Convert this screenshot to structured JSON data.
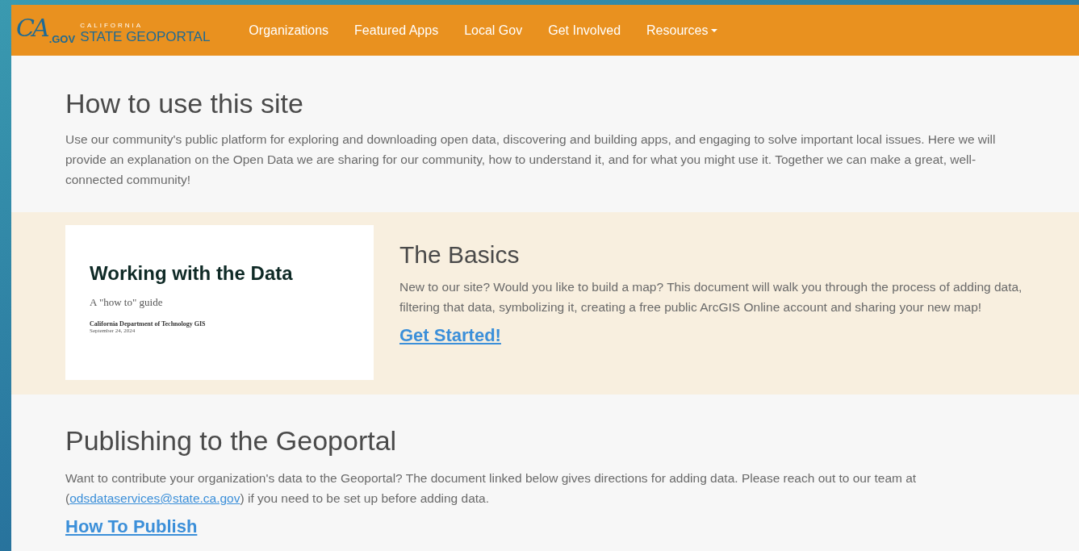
{
  "header": {
    "logo": {
      "mark": "CA",
      "gov": ".GOV",
      "state": "CALIFORNIA",
      "title": "STATE GEOPORTAL"
    },
    "nav": [
      {
        "label": "Organizations",
        "dropdown": false
      },
      {
        "label": "Featured Apps",
        "dropdown": false
      },
      {
        "label": "Local Gov",
        "dropdown": false
      },
      {
        "label": "Get Involved",
        "dropdown": false
      },
      {
        "label": "Resources",
        "dropdown": true
      }
    ]
  },
  "intro": {
    "title": "How to use this site",
    "text": "Use our community's public platform for exploring and downloading open data, discovering and building apps, and engaging to solve important local issues. Here we will provide an explanation on the Open Data we are sharing for our community, how to understand it, and for what you might use it. Together we can make a great, well-connected community!"
  },
  "basics": {
    "document": {
      "title": "Working with the Data",
      "subtitle": "A \"how to\" guide",
      "author": "California Department of Technology GIS",
      "date": "September 24, 2024"
    },
    "title": "The Basics",
    "text": "New to our site? Would you like to build a map? This document will walk you through the process of adding data, filtering that data, symbolizing it, creating a free public ArcGIS Online account and sharing your new map!",
    "link": "Get Started!"
  },
  "publishing": {
    "title": "Publishing to the Geoportal",
    "text_before": "Want to contribute your organization's data to the Geoportal?  The document linked below gives directions for adding data.  Please reach out to our team at (",
    "email": "odsdataservices@state.ca.gov",
    "text_after": ")  if you need to be set up before adding data.",
    "link": "How To Publish"
  }
}
